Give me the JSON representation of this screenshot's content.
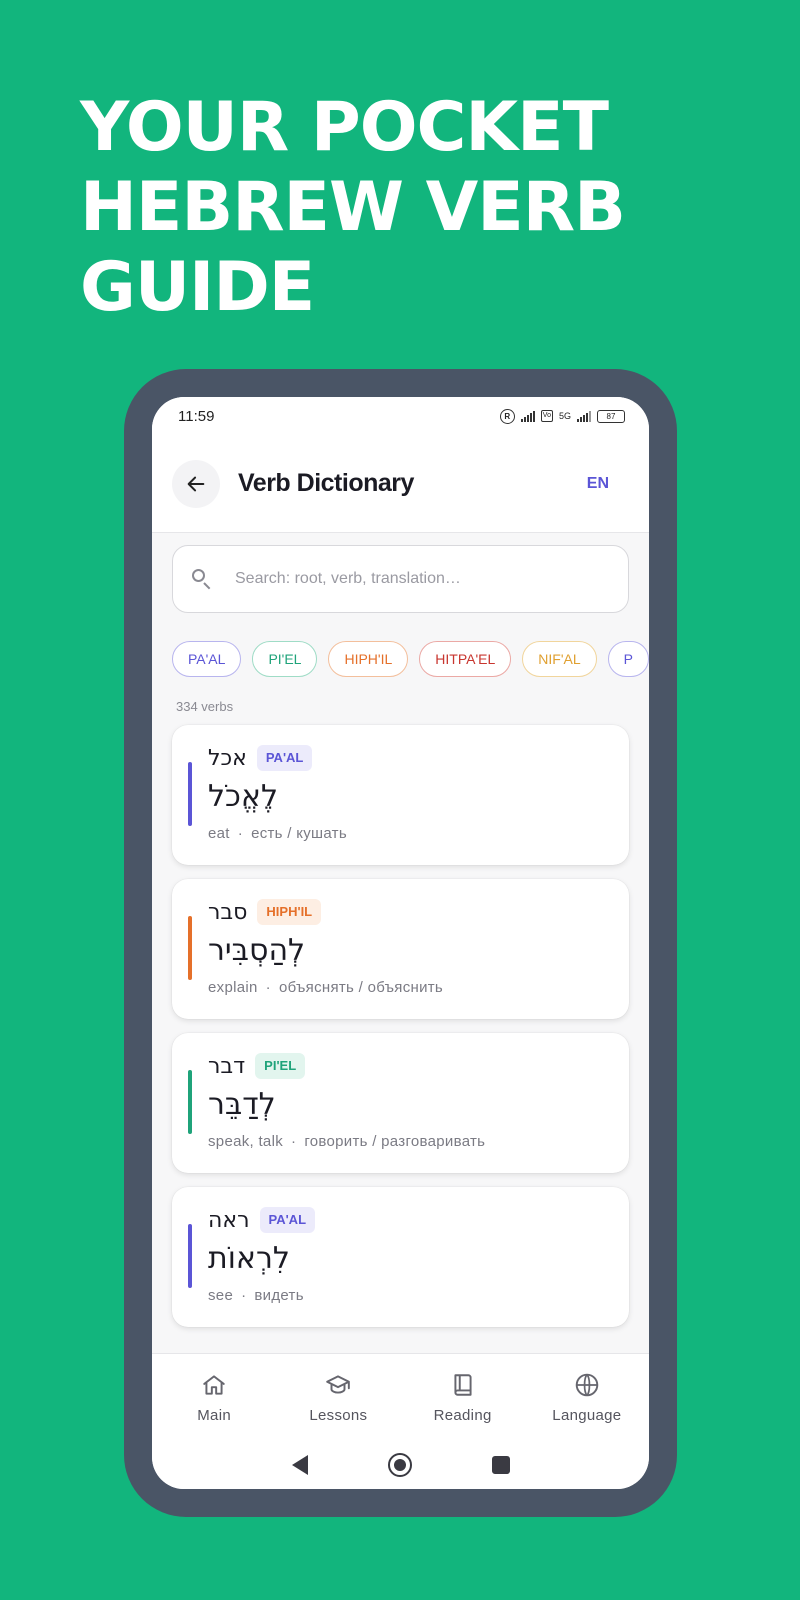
{
  "headline": "YOUR POCKET HEBREW VERB GUIDE",
  "status_bar": {
    "time": "11:59",
    "battery": "87",
    "network": "5G"
  },
  "app_bar": {
    "title": "Verb Dictionary",
    "language_button": "EN",
    "back_icon": "arrow-left-icon"
  },
  "search": {
    "placeholder": "Search: root, verb, translation…",
    "value": ""
  },
  "filters": [
    {
      "label": "PA'AL",
      "color": "#5b55d6"
    },
    {
      "label": "PI'EL",
      "color": "#1fa37a"
    },
    {
      "label": "HIPH'IL",
      "color": "#e5702a"
    },
    {
      "label": "HITPA'EL",
      "color": "#c8362f"
    },
    {
      "label": "NIF'AL",
      "color": "#e0a030"
    },
    {
      "label": "P",
      "color": "#5b55d6"
    }
  ],
  "verb_count": "334 verbs",
  "verbs": [
    {
      "root": "אכל",
      "binyan": "PA'AL",
      "infinitive": "לֶאֱכֹל",
      "english": "eat",
      "russian": "есть / кушать",
      "accent": "#5b55d6",
      "badge_bg": "#ecebfb",
      "badge_fg": "#5b55d6"
    },
    {
      "root": "סבר",
      "binyan": "HIPH'IL",
      "infinitive": "לְהַסְבִּיר",
      "english": "explain",
      "russian": "объяснять / объяснить",
      "accent": "#e5702a",
      "badge_bg": "#fdeee3",
      "badge_fg": "#e5702a"
    },
    {
      "root": "דבר",
      "binyan": "PI'EL",
      "infinitive": "לְדַבֵּר",
      "english": "speak, talk",
      "russian": "говорить / разговаривать",
      "accent": "#1fa37a",
      "badge_bg": "#e2f5ee",
      "badge_fg": "#1fa37a"
    },
    {
      "root": "ראה",
      "binyan": "PA'AL",
      "infinitive": "לִרְאוֹת",
      "english": "see",
      "russian": "видеть",
      "accent": "#5b55d6",
      "badge_bg": "#ecebfb",
      "badge_fg": "#5b55d6"
    }
  ],
  "bottom_nav": [
    {
      "label": "Main",
      "icon": "home-icon"
    },
    {
      "label": "Lessons",
      "icon": "graduation-cap-icon"
    },
    {
      "label": "Reading",
      "icon": "book-icon"
    },
    {
      "label": "Language",
      "icon": "globe-icon"
    }
  ],
  "colors": {
    "background": "#12b57d",
    "phone_frame": "#4a5566",
    "accent": "#5b55d6"
  }
}
